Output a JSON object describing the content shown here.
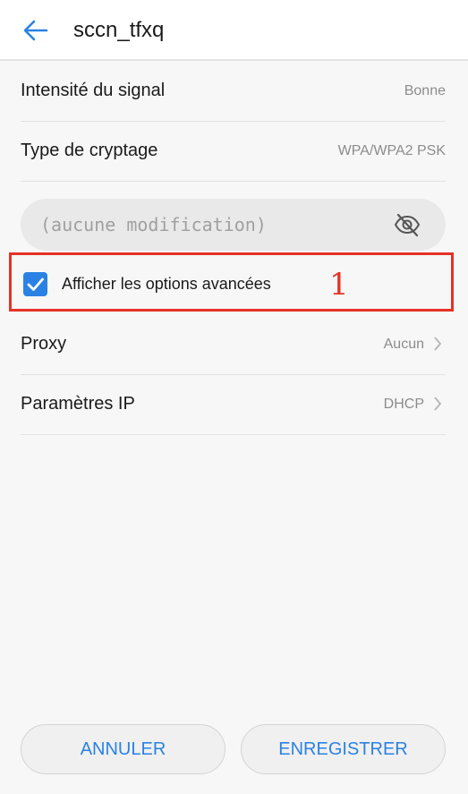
{
  "header": {
    "title": "sccn_tfxq",
    "back_icon": "arrow-left-icon"
  },
  "rows": {
    "signal": {
      "label": "Intensité du signal",
      "value": "Bonne"
    },
    "encryption": {
      "label": "Type de cryptage",
      "value": "WPA/WPA2 PSK"
    },
    "proxy": {
      "label": "Proxy",
      "value": "Aucun"
    },
    "ip": {
      "label": "Paramètres IP",
      "value": "DHCP"
    }
  },
  "password": {
    "placeholder": "(aucune modification)",
    "toggle_icon": "eye-off-icon"
  },
  "advanced": {
    "label": "Afficher les options avancées",
    "checked": true
  },
  "annotation": {
    "text": "1",
    "color": "#e53226"
  },
  "buttons": {
    "cancel": "ANNULER",
    "save": "ENREGISTRER"
  },
  "colors": {
    "accent": "#2a82e4",
    "annotation_red": "#e53226",
    "background": "#f7f7f7"
  }
}
